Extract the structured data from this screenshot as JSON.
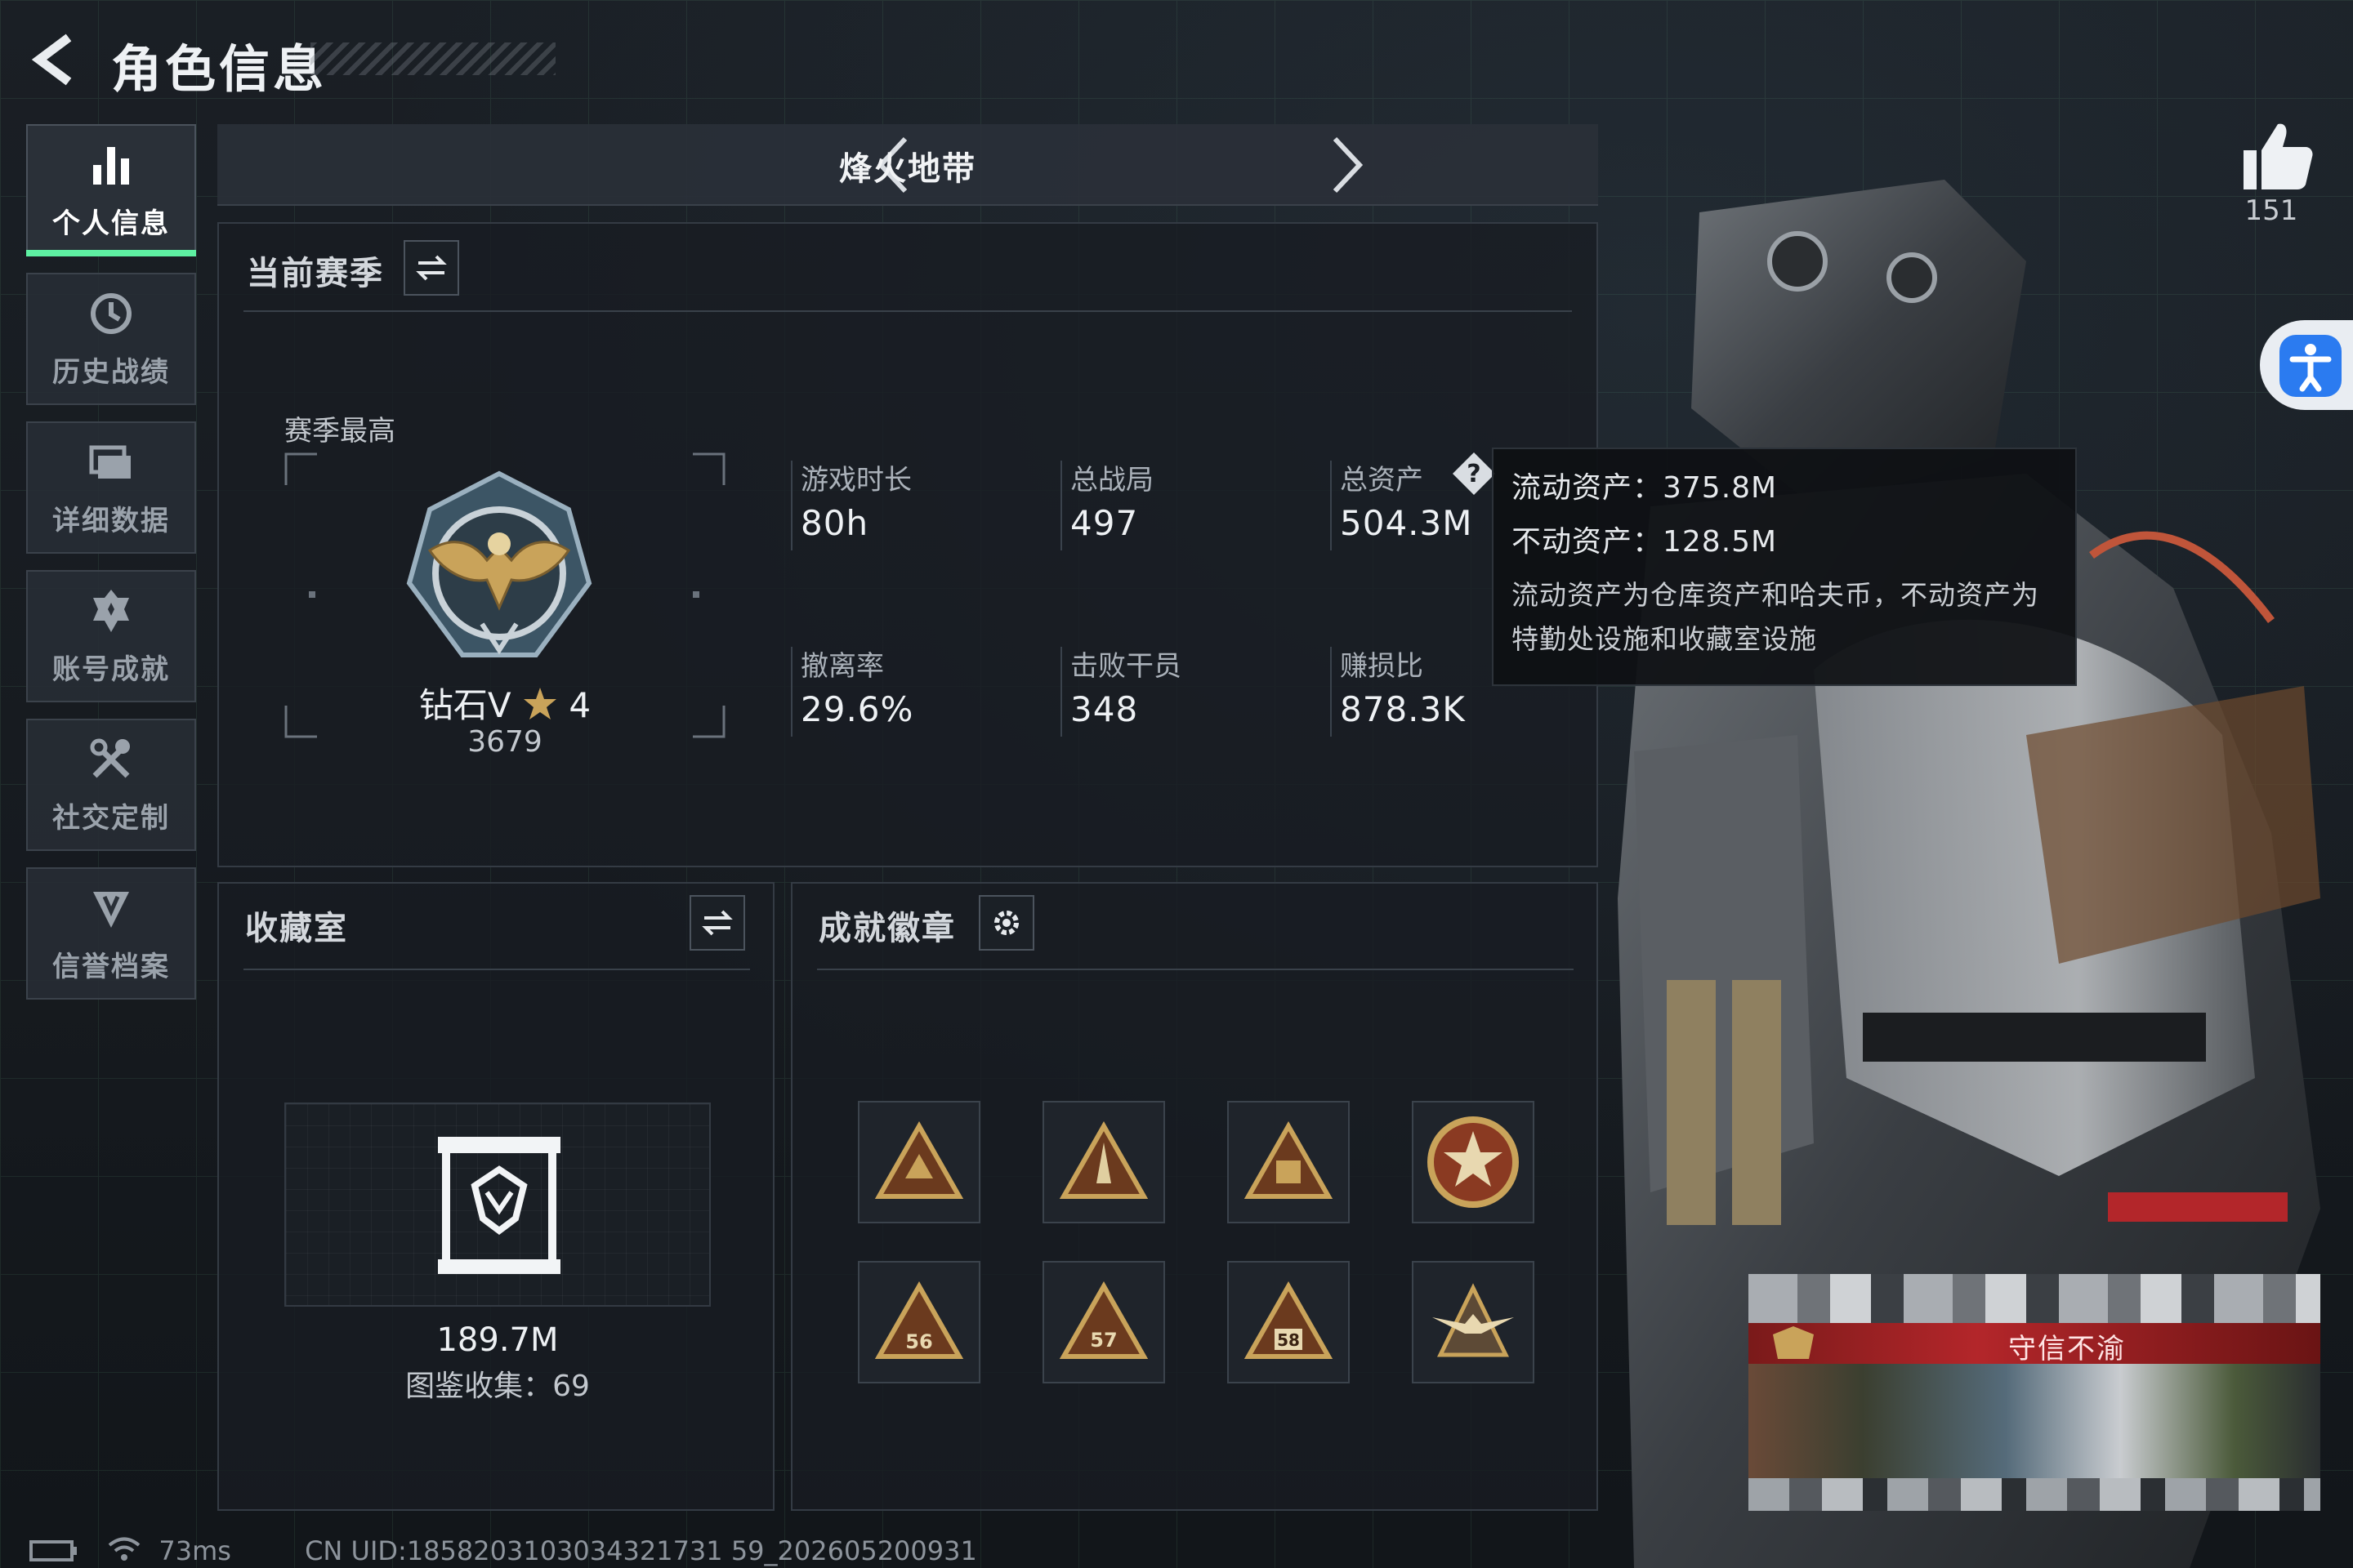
{
  "header": {
    "title": "角色信息"
  },
  "sidebar": {
    "items": [
      {
        "label": "个人信息",
        "active": true
      },
      {
        "label": "历史战绩"
      },
      {
        "label": "详细数据"
      },
      {
        "label": "账号成就"
      },
      {
        "label": "社交定制"
      },
      {
        "label": "信誉档案"
      }
    ]
  },
  "mode": {
    "title": "烽火地带"
  },
  "season": {
    "title": "当前赛季",
    "best_label": "赛季最高",
    "rank_name": "钻石V",
    "rank_stars": "4",
    "rank_score": "3679",
    "stats": [
      {
        "label": "游戏时长",
        "value": "80h"
      },
      {
        "label": "总战局",
        "value": "497"
      },
      {
        "label": "总资产",
        "value": "504.3M"
      },
      {
        "label": "撤离率",
        "value": "29.6%"
      },
      {
        "label": "击败干员",
        "value": "348"
      },
      {
        "label": "赚损比",
        "value": "878.3K"
      }
    ]
  },
  "tooltip": {
    "liquid": "流动资产：375.8M",
    "fixed": "不动资产：128.5M",
    "desc": "流动资产为仓库资产和哈夫币，不动资产为特勤处设施和收藏室设施"
  },
  "collection": {
    "title": "收藏室",
    "value": "189.7M",
    "count_label": "图鉴收集：69"
  },
  "achievements": {
    "title": "成就徽章",
    "badges": [
      "56",
      "57",
      "58"
    ]
  },
  "likes": {
    "count": "151"
  },
  "card": {
    "name": "守信不渝"
  },
  "footer": {
    "ping": "73ms",
    "uid": "CN UID:1858203103034321731 59_202605200931"
  },
  "colors": {
    "accent": "#5ef0a2",
    "tooltip_bg": "#0e1013",
    "card_band": "#b3262a",
    "gold": "#c9a35a"
  }
}
